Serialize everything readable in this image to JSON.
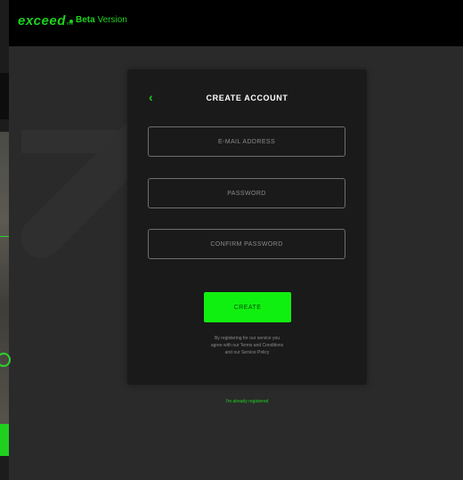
{
  "header": {
    "logo_text": "exceed",
    "logo_suffix": "me",
    "beta_label": "Beta",
    "beta_suffix": "Version"
  },
  "card": {
    "back_icon": "chevron-left-icon",
    "title": "CREATE ACCOUNT",
    "fields": {
      "email_placeholder": "E-MAIL ADDRESS",
      "password_placeholder": "PASSWORD",
      "confirm_placeholder": "CONFIRM PASSWORD"
    },
    "create_label": "CREATE",
    "terms_lines": [
      "By registering for our service you",
      "agree with our Terms and Conditions",
      "and our Service Policy"
    ]
  },
  "already_registered": "I'm already registered",
  "colors": {
    "accent": "#1ed21e",
    "button": "#10f010",
    "background": "#2a2a2a",
    "card": "#1a1a1a",
    "header": "#000000"
  }
}
